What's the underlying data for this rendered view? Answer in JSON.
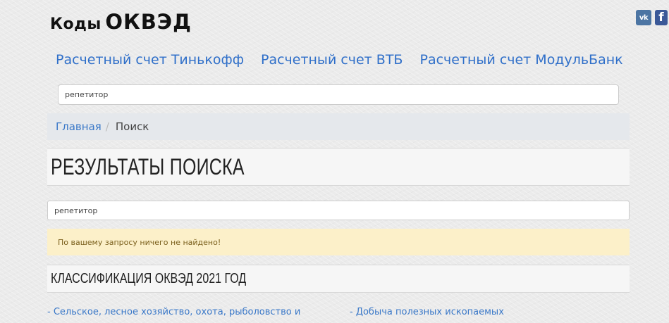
{
  "header": {
    "logo_small": "Коды",
    "logo_big": "ОКВЭД"
  },
  "social": {
    "vk_label": "vk",
    "fb_label": "f"
  },
  "banks": [
    {
      "label": "Расчетный счет Тинькофф"
    },
    {
      "label": "Расчетный счет ВТБ"
    },
    {
      "label": "Расчетный счет МодульБанк"
    }
  ],
  "search_top": {
    "value": "репетитор"
  },
  "breadcrumb": {
    "home": "Главная",
    "separator": "/",
    "current": "Поиск"
  },
  "main": {
    "title": "РЕЗУЛЬТАТЫ ПОИСКА",
    "search_value": "репетитор",
    "alert": "По вашему запросу ничего не найдено!",
    "section_title": "КЛАССИФИКАЦИЯ ОКВЭД 2021 ГОД",
    "classes": [
      {
        "label": "- Сельское, лесное хозяйство, охота, рыболовство и"
      },
      {
        "label": "- Добыча полезных ископаемых"
      }
    ]
  },
  "colors": {
    "link": "#3a78c8",
    "bank_link": "#2f6fc9",
    "alert_bg": "#fcf0c9",
    "breadcrumb_bg": "#e5e8ec"
  }
}
